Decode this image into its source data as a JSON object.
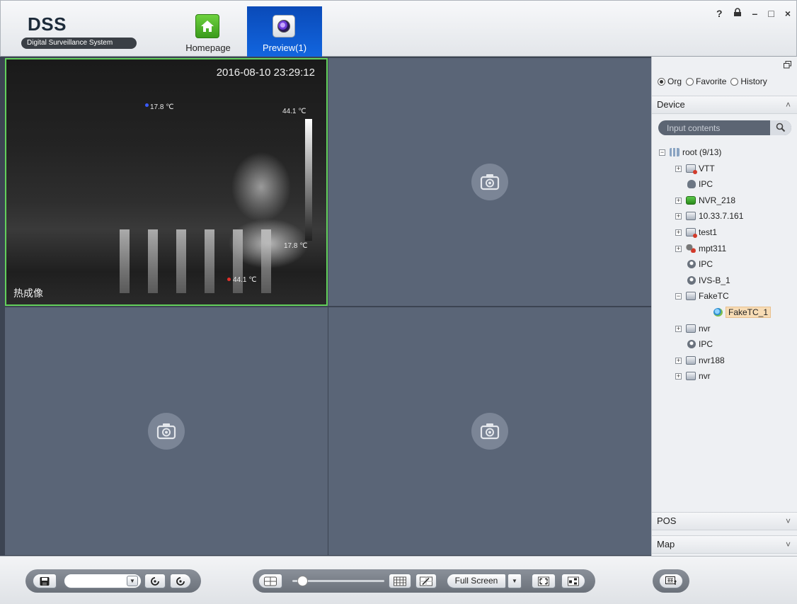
{
  "app": {
    "logo_title": "DSS",
    "logo_subtitle": "Digital Surveillance System"
  },
  "nav_tabs": [
    {
      "label": "Homepage",
      "icon": "home-icon",
      "active": false
    },
    {
      "label": "Preview(1)",
      "icon": "camera-lens-icon",
      "active": true
    }
  ],
  "window_controls": {
    "help": "?",
    "lock": "🔒",
    "minimize": "–",
    "maximize": "□",
    "close": "×"
  },
  "video": {
    "cells": [
      {
        "state": "playing",
        "timestamp": "2016-08-10 23:29:12",
        "channel_label": "热成像",
        "temps": {
          "point_low": "17.8 ℃",
          "scale_max": "44.1 ℃",
          "scale_min": "17.8 ℃",
          "point_high": "44.1 ℃"
        }
      },
      {
        "state": "empty",
        "icon": "no-video-camera-icon"
      },
      {
        "state": "empty",
        "icon": "no-video-camera-icon"
      },
      {
        "state": "empty",
        "icon": "no-video-camera-icon"
      }
    ],
    "colors": {
      "selected_border": "#63d05c",
      "empty_cell": "#5a6577",
      "grid_bg": "#3c4452"
    }
  },
  "right_panel": {
    "restore_icon": "restore-window-icon",
    "filter_options": [
      {
        "label": "Org",
        "checked": true
      },
      {
        "label": "Favorite",
        "checked": false
      },
      {
        "label": "History",
        "checked": false
      }
    ],
    "device_section": {
      "title": "Device",
      "expanded": true
    },
    "search": {
      "placeholder": "Input contents"
    },
    "tree": [
      {
        "label": "root (9/13)",
        "level": 0,
        "expander": "minus",
        "icon": "root-org-icon"
      },
      {
        "label": "VTT",
        "level": 1,
        "expander": "plus",
        "icon": "device-offline-icon"
      },
      {
        "label": "IPC",
        "level": 1,
        "expander": "none",
        "icon": "ipc-camera-icon"
      },
      {
        "label": "NVR_218",
        "level": 1,
        "expander": "plus",
        "icon": "nvr-online-icon"
      },
      {
        "label": "10.33.7.161",
        "level": 1,
        "expander": "plus",
        "icon": "device-icon"
      },
      {
        "label": "test1",
        "level": 1,
        "expander": "plus",
        "icon": "device-offline-icon"
      },
      {
        "label": "mpt311",
        "level": 1,
        "expander": "plus",
        "icon": "mpt-device-icon"
      },
      {
        "label": "IPC",
        "level": 1,
        "expander": "none",
        "icon": "dome-camera-icon"
      },
      {
        "label": "IVS-B_1",
        "level": 1,
        "expander": "none",
        "icon": "dome-camera-icon"
      },
      {
        "label": "FakeTC",
        "level": 1,
        "expander": "minus",
        "icon": "device-icon"
      },
      {
        "label": "FakeTC_1",
        "level": 2,
        "expander": "none",
        "icon": "thermal-channel-icon",
        "selected": true
      },
      {
        "label": "nvr",
        "level": 1,
        "expander": "plus",
        "icon": "device-icon"
      },
      {
        "label": "IPC",
        "level": 1,
        "expander": "none",
        "icon": "dome-camera-icon"
      },
      {
        "label": "nvr188",
        "level": 1,
        "expander": "plus",
        "icon": "device-icon"
      },
      {
        "label": "nvr",
        "level": 1,
        "expander": "plus",
        "icon": "device-icon"
      }
    ],
    "collapsed_sections": [
      {
        "title": "POS"
      },
      {
        "title": "Map"
      }
    ]
  },
  "bottom_bar": {
    "view_select_value": "",
    "fullscreen_label": "Full Screen",
    "split_slider_level": 0.05,
    "icons": {
      "save": "save-icon",
      "refresh_1": "refresh-icon",
      "refresh_2": "refresh-icon",
      "split": "split-window-icon",
      "grid": "grid-layout-icon",
      "custom_grid": "custom-layout-icon",
      "fit": "fit-screen-icon",
      "layout": "window-layout-icon",
      "tv": "tv-wall-icon"
    }
  }
}
